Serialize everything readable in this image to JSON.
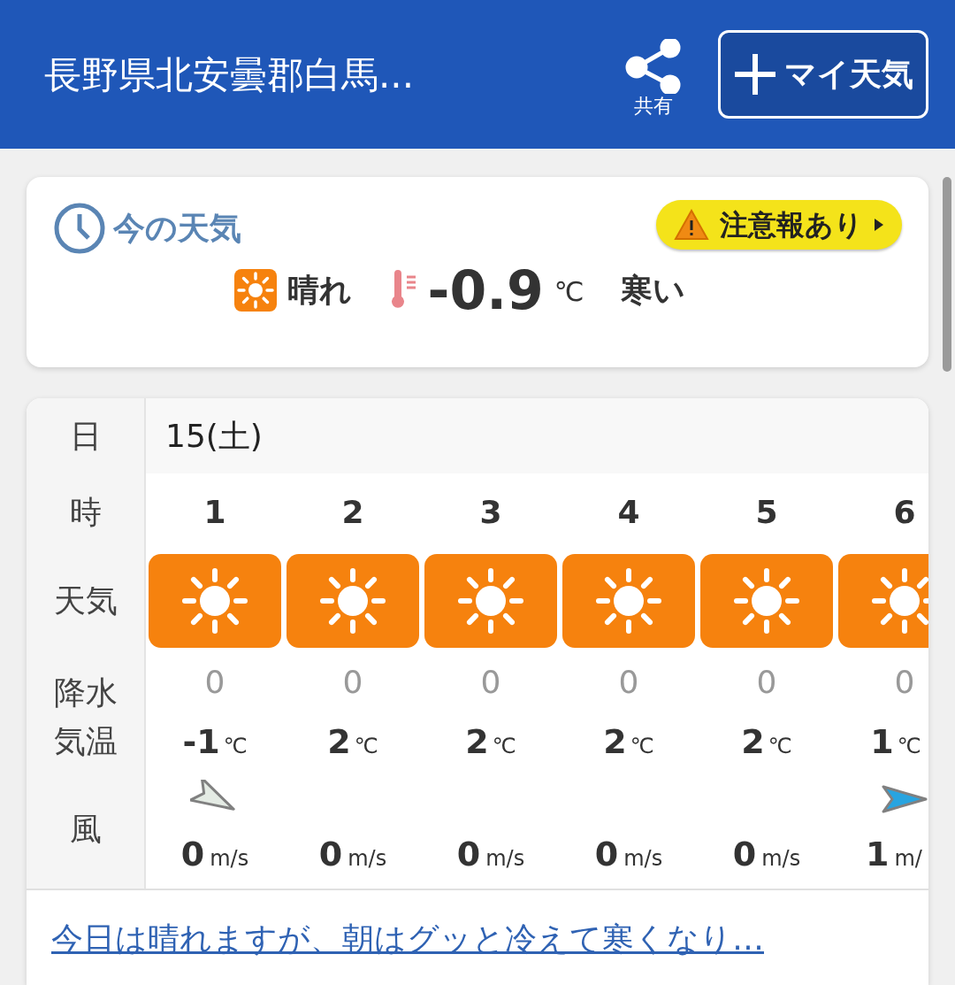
{
  "header": {
    "title": "長野県北安曇郡白馬...",
    "share_label": "共有",
    "my_weather_button": "マイ天気"
  },
  "current": {
    "heading": "今の天気",
    "alert_badge": "注意報あり",
    "condition": "晴れ",
    "temperature": "-0.9",
    "unit": "℃",
    "feeling": "寒い"
  },
  "forecast": {
    "row_labels": {
      "date": "日",
      "hour": "時",
      "weather": "天気",
      "precip": "降水",
      "temp": "気温",
      "wind": "風"
    },
    "date": "15(土)",
    "hours": [
      {
        "hour": "1",
        "kind": "sunny",
        "precip": "0",
        "temp": "-1",
        "temp_unit": "℃",
        "wind_arrow": {
          "kind": "southeast",
          "color": "#e4ebe4"
        },
        "wind_speed": "0",
        "wind_unit": "m/s"
      },
      {
        "hour": "2",
        "kind": "sunny",
        "precip": "0",
        "temp": "2",
        "temp_unit": "℃",
        "wind_speed": "0",
        "wind_unit": "m/s"
      },
      {
        "hour": "3",
        "kind": "sunny",
        "precip": "0",
        "temp": "2",
        "temp_unit": "℃",
        "wind_speed": "0",
        "wind_unit": "m/s"
      },
      {
        "hour": "4",
        "kind": "sunny",
        "precip": "0",
        "temp": "2",
        "temp_unit": "℃",
        "wind_speed": "0",
        "wind_unit": "m/s"
      },
      {
        "hour": "5",
        "kind": "sunny",
        "precip": "0",
        "temp": "2",
        "temp_unit": "℃",
        "wind_speed": "0",
        "wind_unit": "m/s"
      },
      {
        "hour": "6",
        "kind": "sunny",
        "precip": "0",
        "temp": "1",
        "temp_unit": "℃",
        "wind_arrow": {
          "kind": "east",
          "color": "#28a4e0"
        },
        "wind_speed": "1",
        "wind_unit": "m/"
      }
    ]
  },
  "comment": {
    "text": "今日は晴れますが、朝はグッと冷えて寒くなり…"
  }
}
